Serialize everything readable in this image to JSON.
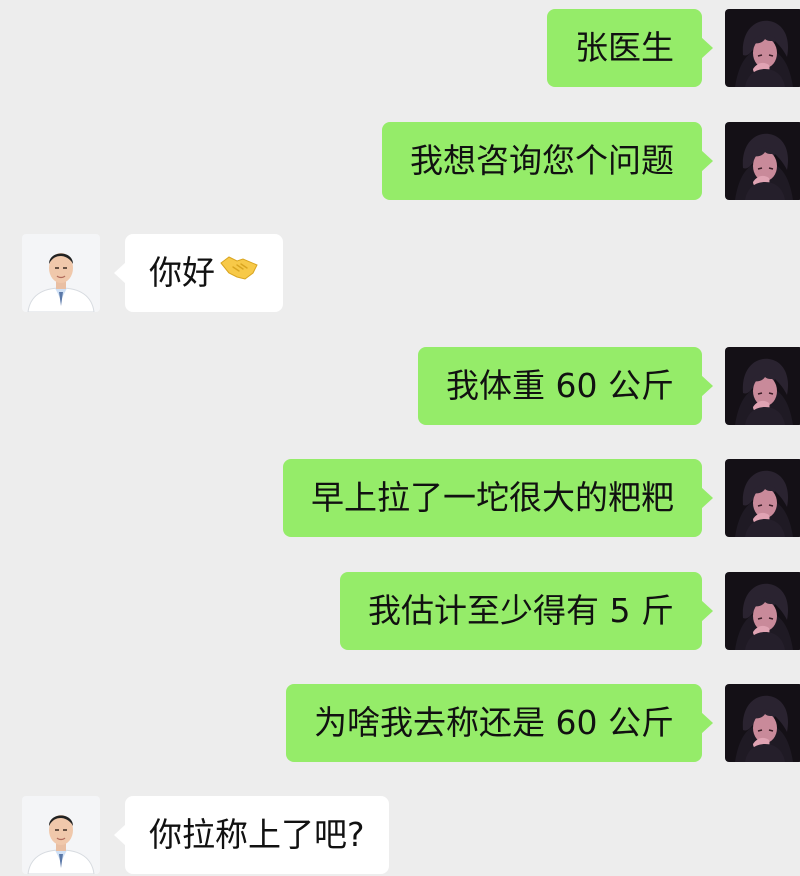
{
  "colors": {
    "background": "#ededed",
    "sent_bubble": "#95ec69",
    "received_bubble": "#ffffff",
    "text": "#111111"
  },
  "messages": [
    {
      "sender": "me",
      "text": "张医生"
    },
    {
      "sender": "me",
      "text": "我想咨询您个问题"
    },
    {
      "sender": "doctor",
      "text": "你好",
      "icon": "handshake-emoji-icon"
    },
    {
      "sender": "me",
      "text": "我体重 60 公斤"
    },
    {
      "sender": "me",
      "text": "早上拉了一坨很大的粑粑"
    },
    {
      "sender": "me",
      "text": "我估计至少得有 5 斤"
    },
    {
      "sender": "me",
      "text": "为啥我去称还是 60 公斤"
    },
    {
      "sender": "doctor",
      "text": "你拉称上了吧?"
    }
  ]
}
